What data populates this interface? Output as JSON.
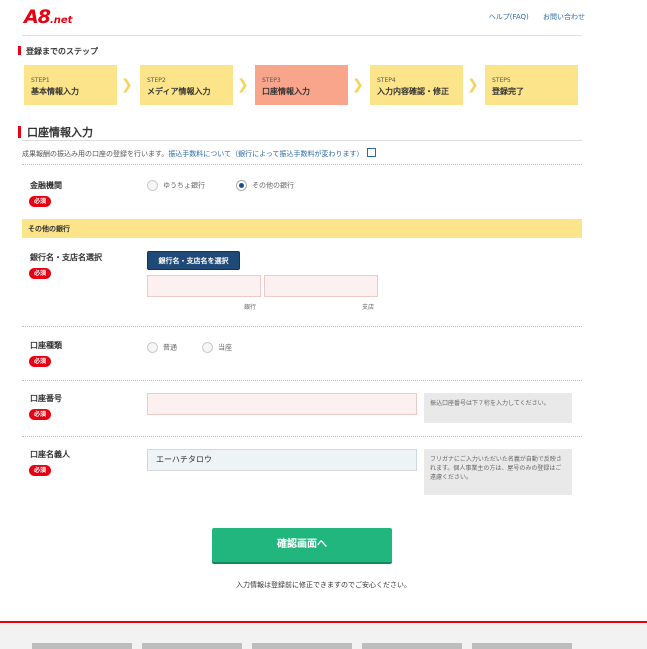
{
  "header": {
    "logo_main": "A8",
    "logo_sub": ".net",
    "links": [
      "ヘルプ(FAQ)",
      "お問い合わせ"
    ]
  },
  "steps_title": "登録までのステップ",
  "steps": [
    {
      "num": "STEP1",
      "label": "基本情報入力",
      "active": false
    },
    {
      "num": "STEP2",
      "label": "メディア情報入力",
      "active": false
    },
    {
      "num": "STEP3",
      "label": "口座情報入力",
      "active": true
    },
    {
      "num": "STEP4",
      "label": "入力内容確認・修正",
      "active": false
    },
    {
      "num": "STEP5",
      "label": "登録完了",
      "active": false
    }
  ],
  "section": {
    "title": "口座情報入力",
    "intro_text": "成果報酬の振込み用の口座の登録を行います。",
    "intro_link": "振込手数料について（銀行によって振込手数料が変わります）"
  },
  "form": {
    "required_label": "必須",
    "institution": {
      "label": "金融機関",
      "options": [
        "ゆうちょ銀行",
        "その他の銀行"
      ],
      "selected": "その他の銀行"
    },
    "other_bank_heading": "その他の銀行",
    "bank": {
      "label": "銀行名・支店名選択",
      "button": "銀行名・支店名を選択",
      "bank_caption": "銀行",
      "branch_caption": "支店"
    },
    "account_type": {
      "label": "口座種類",
      "options": [
        "普通",
        "当座"
      ]
    },
    "account_number": {
      "label": "口座番号",
      "help": "振込口座番号は下７桁を入力してください。"
    },
    "account_holder": {
      "label": "口座名義人",
      "value": "エーハチタロウ",
      "help": "フリガナにご入力いただいた名義が自動で反映されます。個人事業主の方は、屋号のみの登録はご遠慮ください。"
    }
  },
  "confirm_button": "確認画面へ",
  "footnote": "入力情報は登録前に修正できますのでご安心ください。",
  "colors": {
    "brand_red": "#e60012",
    "step_yellow": "#fbe489",
    "step_active": "#f8a58c",
    "confirm_green": "#22b67f",
    "select_button": "#1f4a78"
  }
}
